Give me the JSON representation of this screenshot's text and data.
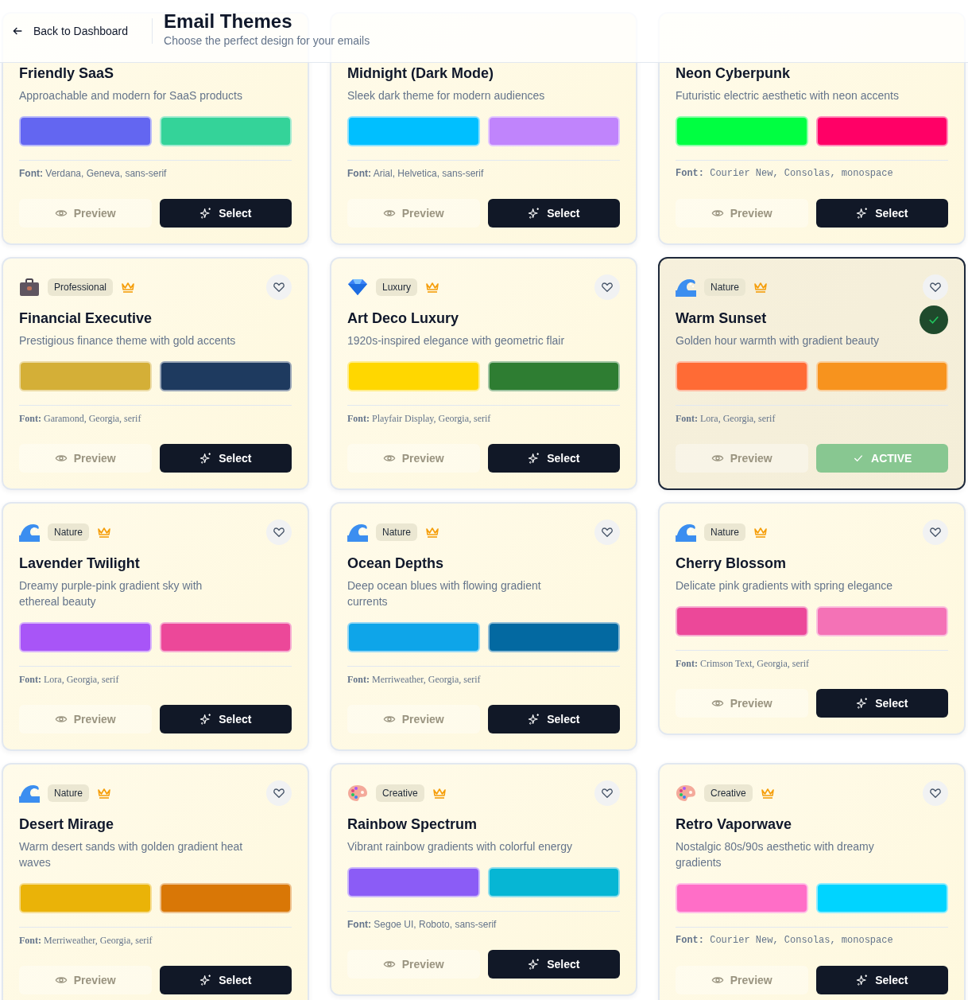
{
  "header": {
    "back_link": "Back to Dashboard",
    "title": "Email Themes",
    "subtitle": "Choose the perfect design for your emails"
  },
  "themes": [
    {
      "name": "Friendly SaaS",
      "description": "Approachable and modern for SaaS products",
      "swatches": [
        {
          "color": "#6366f1"
        },
        {
          "color": "#34d399"
        }
      ],
      "font_label": "Font:",
      "font": "Verdana, Geneva, sans-serif",
      "preview": "Preview",
      "button": "Select",
      "active": false
    },
    {
      "name": "Midnight (Dark Mode)",
      "description": "Sleek dark theme for modern audiences",
      "swatches": [
        {
          "color": "#00bfff"
        },
        {
          "color": "#c084fc"
        }
      ],
      "font_label": "Font:",
      "font": "Arial, Helvetica, sans-serif",
      "preview": "Preview",
      "button": "Select",
      "active": false
    },
    {
      "name": "Neon Cyberpunk",
      "description": "Futuristic electric aesthetic with neon accents",
      "swatches": [
        {
          "color": "#00ff41"
        },
        {
          "color": "#ff0066"
        }
      ],
      "font_label": "Font:",
      "font": "Courier New, Consolas, monospace",
      "preview": "Preview",
      "button": "Select",
      "active": false
    },
    {
      "kind": "briefcase",
      "category": "Professional",
      "name": "Financial Executive",
      "description": "Prestigious finance theme with gold accents",
      "swatches": [
        {
          "color": "#d4af37"
        },
        {
          "color": "#1e3a5f"
        }
      ],
      "font_label": "Font:",
      "font": "Garamond, Georgia, serif",
      "preview": "Preview",
      "button": "Select",
      "active": false
    },
    {
      "kind": "gem",
      "category": "Luxury",
      "name": "Art Deco Luxury",
      "description": "1920s-inspired elegance with geometric flair",
      "swatches": [
        {
          "color": "#ffd700"
        },
        {
          "color": "#2e7d32"
        }
      ],
      "font_label": "Font:",
      "font": "Playfair Display, Georgia, serif",
      "preview": "Preview",
      "button": "Select",
      "active": false
    },
    {
      "kind": "wave",
      "category": "Nature",
      "name": "Warm Sunset",
      "description": "Golden hour warmth with gradient beauty",
      "swatches": [
        {
          "color": "#ff6b35"
        },
        {
          "color": "#f7931e"
        }
      ],
      "font_label": "Font:",
      "font": "Lora, Georgia, serif",
      "preview": "Preview",
      "button": "ACTIVE",
      "active": true
    },
    {
      "kind": "wave",
      "category": "Nature",
      "name": "Lavender Twilight",
      "description": "Dreamy purple-pink gradient sky with ethereal beauty",
      "swatches": [
        {
          "color": "#a855f7"
        },
        {
          "color": "#ec4899"
        }
      ],
      "font_label": "Font:",
      "font": "Lora, Georgia, serif",
      "preview": "Preview",
      "button": "Select",
      "active": false
    },
    {
      "kind": "wave",
      "category": "Nature",
      "name": "Ocean Depths",
      "description": "Deep ocean blues with flowing gradient currents",
      "swatches": [
        {
          "color": "#0ea5e9"
        },
        {
          "color": "#0369a1"
        }
      ],
      "font_label": "Font:",
      "font": "Merriweather, Georgia, serif",
      "preview": "Preview",
      "button": "Select",
      "active": false
    },
    {
      "kind": "wave",
      "category": "Nature",
      "name": "Cherry Blossom",
      "description": "Delicate pink gradients with spring elegance",
      "swatches": [
        {
          "color": "#ec4899"
        },
        {
          "color": "#f472b6"
        }
      ],
      "font_label": "Font:",
      "font": "Crimson Text, Georgia, serif",
      "preview": "Preview",
      "button": "Select",
      "active": false
    },
    {
      "kind": "wave",
      "category": "Nature",
      "name": "Desert Mirage",
      "description": "Warm desert sands with golden gradient heat waves",
      "swatches": [
        {
          "color": "#eab308"
        },
        {
          "color": "#d97706"
        }
      ],
      "font_label": "Font:",
      "font": "Merriweather, Georgia, serif",
      "preview": "Preview",
      "button": "Select",
      "active": false
    },
    {
      "kind": "palette",
      "category": "Creative",
      "name": "Rainbow Spectrum",
      "description": "Vibrant rainbow gradients with colorful energy",
      "swatches": [
        {
          "color": "#8b5cf6"
        },
        {
          "color": "#06b6d4"
        }
      ],
      "font_label": "Font:",
      "font": "Segoe UI, Roboto, sans-serif",
      "preview": "Preview",
      "button": "Select",
      "active": false
    },
    {
      "kind": "palette",
      "category": "Creative",
      "name": "Retro Vaporwave",
      "description": "Nostalgic 80s/90s aesthetic with dreamy gradients",
      "swatches": [
        {
          "color": "#ff6ec7"
        },
        {
          "color": "#00d4ff"
        }
      ],
      "font_label": "Font:",
      "font": "Courier New, Consolas, monospace",
      "preview": "Preview",
      "button": "Select",
      "active": false
    }
  ]
}
